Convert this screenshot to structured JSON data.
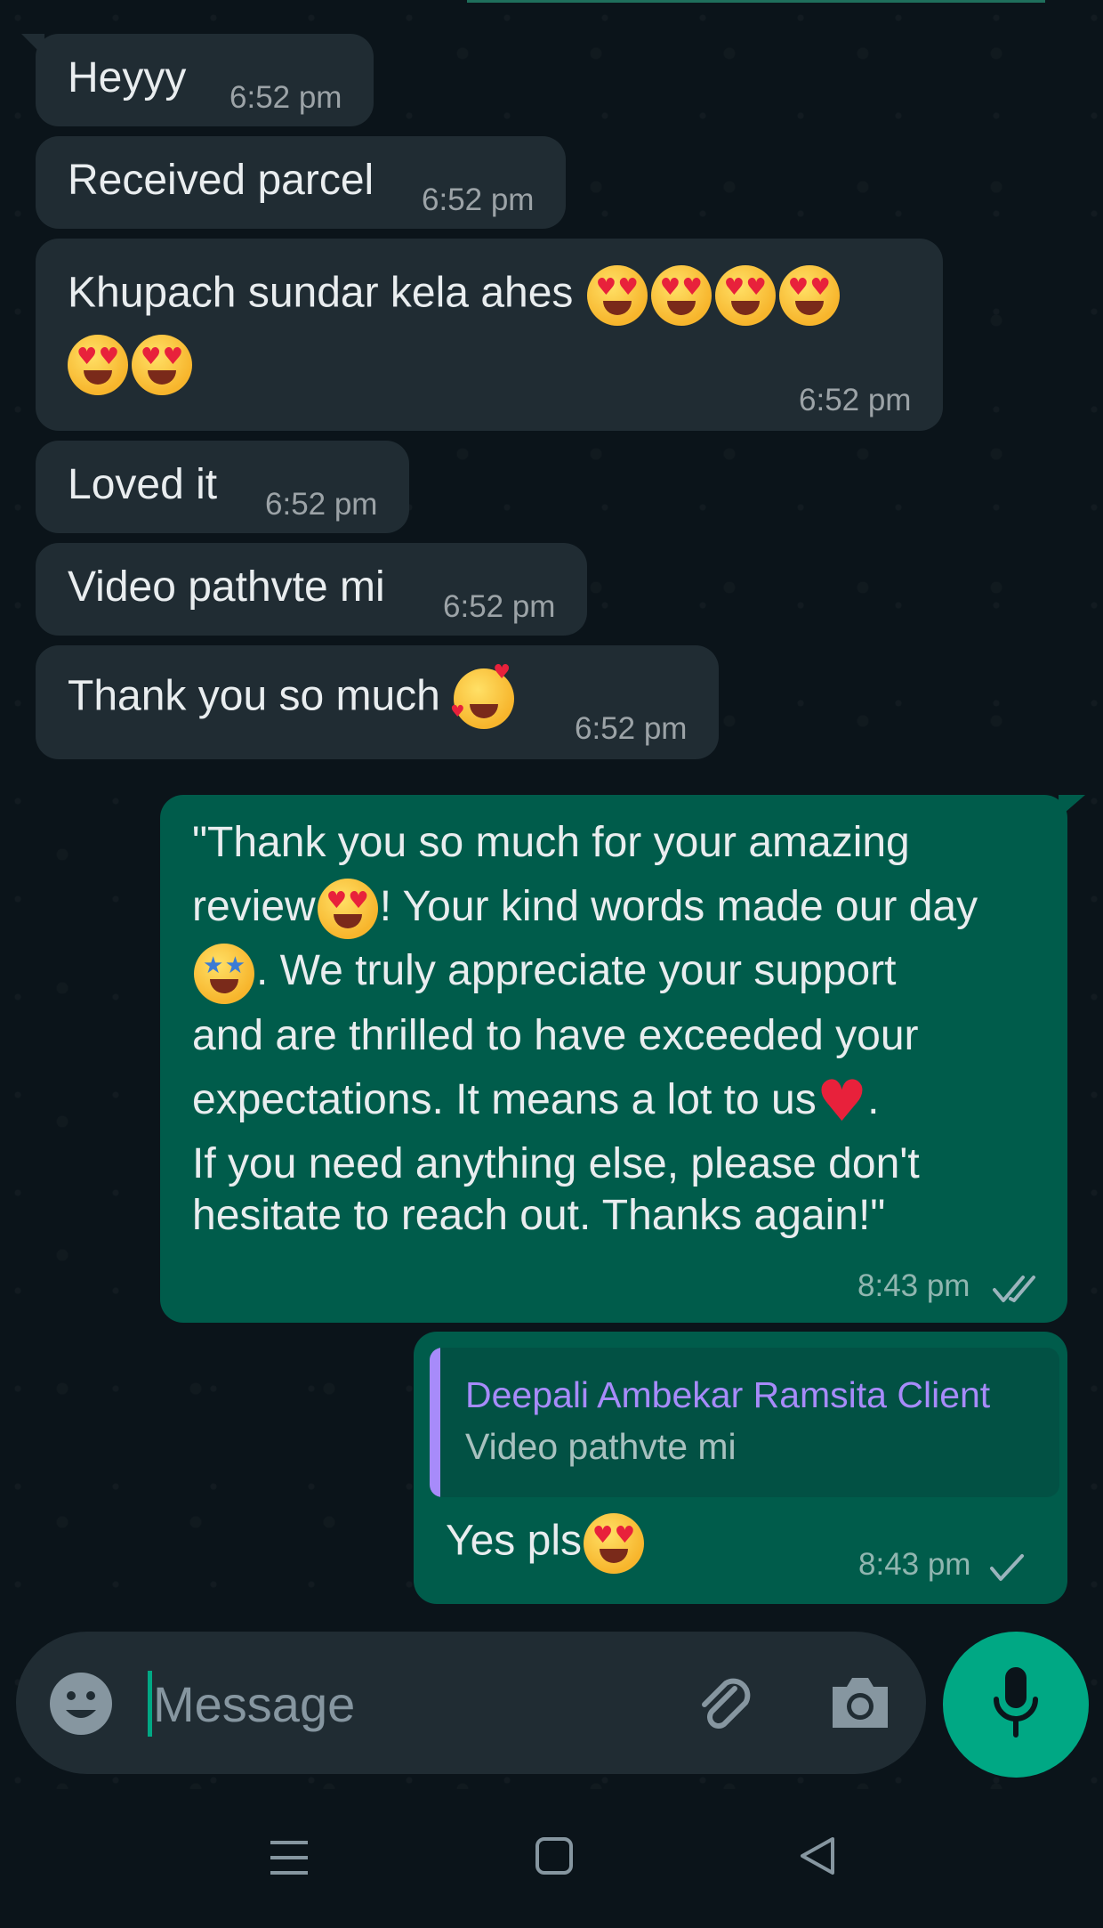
{
  "messages_in": [
    {
      "text": "Heyyy",
      "time": "6:52 pm"
    },
    {
      "text": "Received parcel",
      "time": "6:52 pm"
    },
    {
      "text": "Khupach sundar kela ahes",
      "time": "6:52 pm"
    },
    {
      "text": "Loved it",
      "time": "6:52 pm"
    },
    {
      "text": "Video pathvte mi",
      "time": "6:52 pm"
    },
    {
      "text": "Thank you so much",
      "time": "6:52 pm"
    }
  ],
  "reply_long": {
    "line1": "\"Thank you so much for your amazing",
    "line2a": "review",
    "line2b": "! Your kind words made our day",
    "line3": ". We truly appreciate your support",
    "line4": "and are thrilled to have exceeded your",
    "line5": "expectations. It means a lot to us",
    "line5b": ".",
    "line6": "If you need anything else, please don't",
    "line7": "hesitate to reach out. Thanks again!\"",
    "time": "8:43 pm",
    "status_icon": "double-check-icon"
  },
  "reply_quoted": {
    "quote_name": "Deepali Ambekar Ramsita Client",
    "quote_text": "Video pathvte mi",
    "text": "Yes pls",
    "time": "8:43 pm",
    "status_icon": "single-check-icon"
  },
  "composer": {
    "placeholder": "Message",
    "emoji_icon": "emoji-icon",
    "attach_icon": "paperclip-icon",
    "camera_icon": "camera-icon",
    "mic_icon": "mic-icon"
  },
  "colors": {
    "background": "#0b141a",
    "incoming_bubble": "#202c33",
    "outgoing_bubble": "#005c4b",
    "accent": "#00a884",
    "quote_name": "#a78bfa"
  },
  "navbar": {
    "icons": [
      "menu-icon",
      "home-square-icon",
      "back-triangle-icon"
    ]
  }
}
